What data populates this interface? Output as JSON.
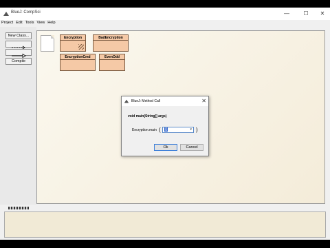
{
  "window": {
    "title": "BlueJ: CompSci"
  },
  "menubar": {
    "items": [
      "Project",
      "Edit",
      "Tools",
      "View",
      "Help"
    ]
  },
  "toolbar": {
    "new_class_label": "New Class...",
    "compile_label": "Compile"
  },
  "classes": [
    {
      "name": "Encryption",
      "dirty": true
    },
    {
      "name": "BadEncryption",
      "dirty": false
    },
    {
      "name": "EncryptionCmd",
      "dirty": false
    },
    {
      "name": "EvenOdd",
      "dirty": false
    }
  ],
  "dialog": {
    "title": "BlueJ:  Method Call",
    "signature": "void main(String[] args)",
    "call_label": "Encryption.main",
    "open_paren": "(",
    "close_paren": ")",
    "arg_value": "{}",
    "ok_label": "Ok",
    "cancel_label": "Cancel"
  },
  "colors": {
    "class_fill": "#f5c9a6",
    "canvas": "#f4ecd9"
  }
}
